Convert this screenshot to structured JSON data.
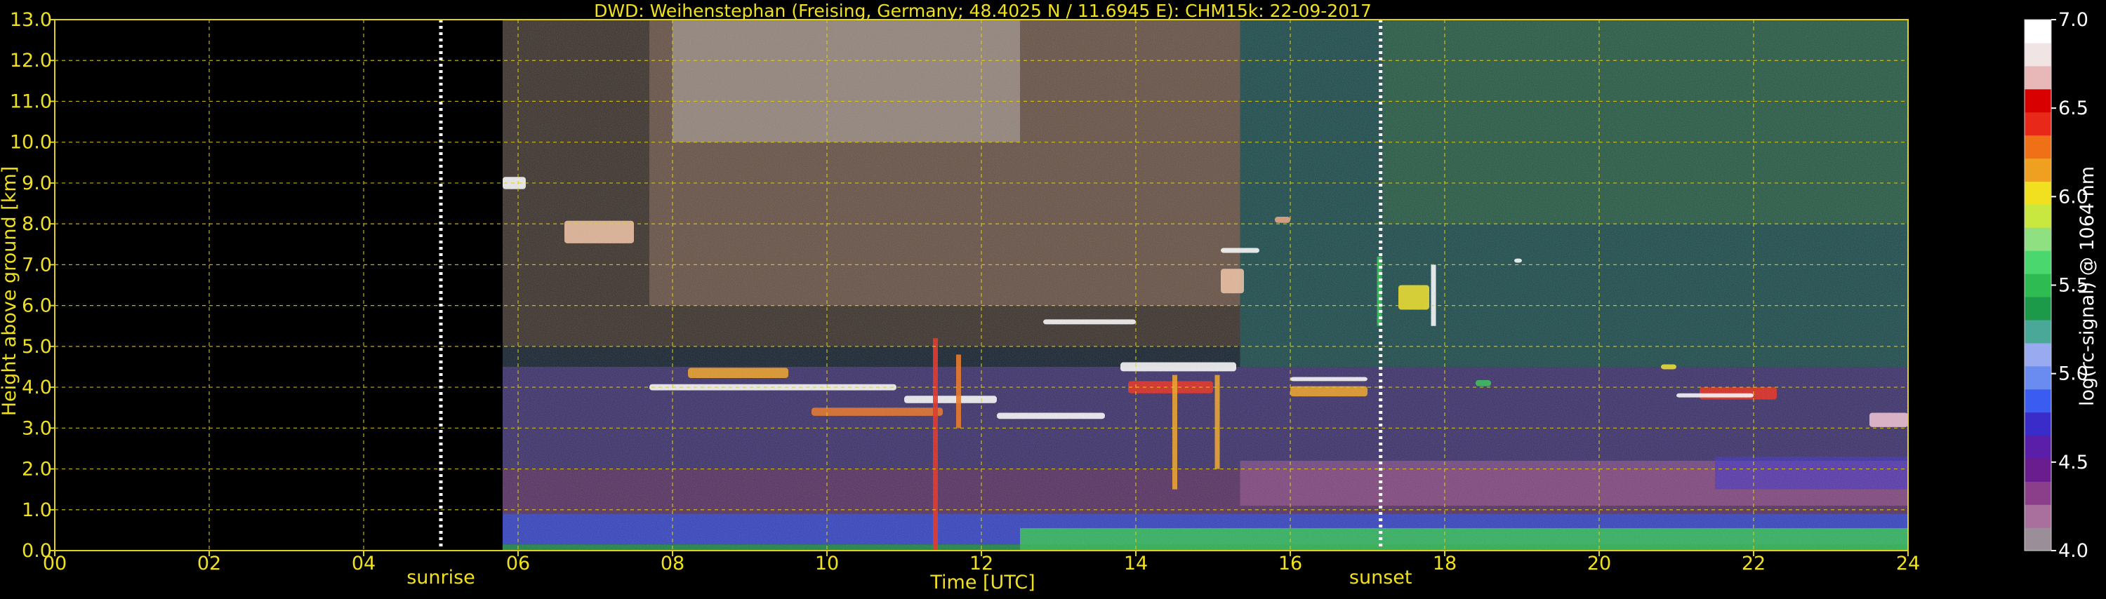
{
  "chart_data": {
    "type": "heatmap",
    "title": "DWD: Weihenstephan (Freising, Germany; 48.4025 N / 11.6945 E):    CHM15k: 22-09-2017",
    "xlabel": "Time [UTC]",
    "ylabel": "Height above ground [km]",
    "colorbar_label": "log(rc-signal) @ 1064 nm",
    "xlim": [
      0,
      24
    ],
    "ylim": [
      0,
      13
    ],
    "x_ticks": [
      "00",
      "02",
      "04",
      "06",
      "08",
      "10",
      "12",
      "14",
      "16",
      "18",
      "20",
      "22",
      "24"
    ],
    "x_tick_values": [
      0,
      2,
      4,
      6,
      8,
      10,
      12,
      14,
      16,
      18,
      20,
      22,
      24
    ],
    "y_ticks": [
      "0.0",
      "1.0",
      "2.0",
      "3.0",
      "4.0",
      "5.0",
      "6.0",
      "7.0",
      "8.0",
      "9.0",
      "10.0",
      "11.0",
      "12.0",
      "13.0"
    ],
    "y_tick_values": [
      0,
      1,
      2,
      3,
      4,
      5,
      6,
      7,
      8,
      9,
      10,
      11,
      12,
      13
    ],
    "colorbar_ticks": [
      "4.0",
      "4.5",
      "5.0",
      "5.5",
      "6.0",
      "6.5",
      "7.0"
    ],
    "colorbar_range": [
      4.0,
      7.0
    ],
    "colorbar_colors": [
      "#9a8e99",
      "#a9709e",
      "#8b3f8a",
      "#6a1d8e",
      "#5a1ea8",
      "#3a2cc8",
      "#3a5cf0",
      "#6a8cf0",
      "#9aaaf0",
      "#4aa898",
      "#1c9a4a",
      "#2ebc52",
      "#4ad86e",
      "#8ee080",
      "#c8e840",
      "#f0e020",
      "#f0a020",
      "#f07018",
      "#e82818",
      "#d80000",
      "#e8b8b8",
      "#f0e4e4",
      "#ffffff"
    ],
    "grid": true,
    "markers": [
      {
        "label": "sunrise",
        "x": 5.0
      },
      {
        "label": "sunset",
        "x": 17.17
      }
    ],
    "data_start_hour": 5.8,
    "background_layers": [
      {
        "x0": 5.8,
        "x1": 24.0,
        "h0": 0,
        "h1": 13.0,
        "color": "#203850",
        "opacity": 0.55
      },
      {
        "x0": 5.8,
        "x1": 15.35,
        "h0": 5.0,
        "h1": 13.0,
        "color": "#4a3628",
        "opacity": 0.7
      },
      {
        "x0": 7.7,
        "x1": 15.35,
        "h0": 6.0,
        "h1": 13.0,
        "color": "#8a6a5a",
        "opacity": 0.55
      },
      {
        "x0": 8.0,
        "x1": 12.5,
        "h0": 10.0,
        "h1": 13.0,
        "color": "#c8c0bc",
        "opacity": 0.45
      },
      {
        "x0": 15.35,
        "x1": 24.0,
        "h0": 4.5,
        "h1": 13.0,
        "color": "#1f6a62",
        "opacity": 0.55
      },
      {
        "x0": 17.2,
        "x1": 24.0,
        "h0": 8.0,
        "h1": 13.0,
        "color": "#3a7a30",
        "opacity": 0.3
      },
      {
        "x0": 5.8,
        "x1": 24.0,
        "h0": 2.0,
        "h1": 4.5,
        "color": "#5a3a9a",
        "opacity": 0.55
      },
      {
        "x0": 5.8,
        "x1": 24.0,
        "h0": 0.9,
        "h1": 2.0,
        "color": "#8a3a8a",
        "opacity": 0.55
      },
      {
        "x0": 15.35,
        "x1": 24.0,
        "h0": 1.1,
        "h1": 2.2,
        "color": "#a85a9a",
        "opacity": 0.5
      },
      {
        "x0": 5.8,
        "x1": 24.0,
        "h0": 0.15,
        "h1": 0.9,
        "color": "#3848d8",
        "opacity": 0.85
      },
      {
        "x0": 12.5,
        "x1": 24.0,
        "h0": 0.0,
        "h1": 0.55,
        "color": "#2ebc52",
        "opacity": 0.9
      },
      {
        "x0": 5.8,
        "x1": 12.5,
        "h0": 0.0,
        "h1": 0.15,
        "color": "#1c9a4a",
        "opacity": 0.8
      },
      {
        "x0": 21.5,
        "x1": 24.0,
        "h0": 1.5,
        "h1": 2.3,
        "color": "#3a2cc8",
        "opacity": 0.6
      }
    ],
    "cloud_features": [
      {
        "x0": 7.7,
        "x1": 10.9,
        "h": 4.0,
        "thickness": 0.15,
        "color": "#ffffff"
      },
      {
        "x0": 8.2,
        "x1": 9.5,
        "h": 4.35,
        "thickness": 0.25,
        "color": "#f0a020"
      },
      {
        "x0": 9.8,
        "x1": 11.5,
        "h": 3.4,
        "thickness": 0.2,
        "color": "#e87020"
      },
      {
        "x0": 11.0,
        "x1": 12.2,
        "h": 3.7,
        "thickness": 0.18,
        "color": "#ffffff"
      },
      {
        "x0": 12.2,
        "x1": 13.6,
        "h": 3.3,
        "thickness": 0.15,
        "color": "#ffffff"
      },
      {
        "x0": 13.8,
        "x1": 15.3,
        "h": 4.5,
        "thickness": 0.22,
        "color": "#ffffff"
      },
      {
        "x0": 13.9,
        "x1": 15.0,
        "h": 4.0,
        "thickness": 0.3,
        "color": "#e82818"
      },
      {
        "x0": 12.8,
        "x1": 14.0,
        "h": 5.6,
        "thickness": 0.12,
        "color": "#ffffff"
      },
      {
        "x0": 16.0,
        "x1": 17.0,
        "h": 3.9,
        "thickness": 0.25,
        "color": "#f0a020"
      },
      {
        "x0": 16.0,
        "x1": 17.0,
        "h": 4.2,
        "thickness": 0.1,
        "color": "#ffffff"
      },
      {
        "x0": 5.8,
        "x1": 6.1,
        "h": 9.0,
        "thickness": 0.3,
        "color": "#ffffff"
      },
      {
        "x0": 6.6,
        "x1": 7.5,
        "h": 7.8,
        "thickness": 0.55,
        "color": "#f0c0a0"
      },
      {
        "x0": 15.1,
        "x1": 15.4,
        "h": 6.6,
        "thickness": 0.6,
        "color": "#f0c0a0"
      },
      {
        "x0": 15.1,
        "x1": 15.6,
        "h": 7.35,
        "thickness": 0.12,
        "color": "#ffffff"
      },
      {
        "x0": 17.4,
        "x1": 17.8,
        "h": 6.2,
        "thickness": 0.6,
        "color": "#f0e020"
      },
      {
        "x0": 21.3,
        "x1": 22.3,
        "h": 3.85,
        "thickness": 0.3,
        "color": "#e82818"
      },
      {
        "x0": 21.0,
        "x1": 22.0,
        "h": 3.8,
        "thickness": 0.1,
        "color": "#ffffff"
      },
      {
        "x0": 23.5,
        "x1": 24.0,
        "h": 3.2,
        "thickness": 0.35,
        "color": "#f0c0d0"
      },
      {
        "x0": 15.8,
        "x1": 16.0,
        "h": 8.1,
        "thickness": 0.15,
        "color": "#e8a080"
      },
      {
        "x0": 20.8,
        "x1": 21.0,
        "h": 4.5,
        "thickness": 0.12,
        "color": "#f0e020"
      },
      {
        "x0": 18.4,
        "x1": 18.6,
        "h": 4.1,
        "thickness": 0.15,
        "color": "#2ebc52"
      },
      {
        "x0": 18.9,
        "x1": 19.0,
        "h": 7.1,
        "thickness": 0.1,
        "color": "#ffffff"
      }
    ],
    "vertical_streaks": [
      {
        "x": 11.4,
        "h0": 0.0,
        "h1": 5.2,
        "color": "#e82818"
      },
      {
        "x": 11.7,
        "h0": 3.0,
        "h1": 4.8,
        "color": "#f07018"
      },
      {
        "x": 14.5,
        "h0": 1.5,
        "h1": 4.3,
        "color": "#f0a020"
      },
      {
        "x": 15.05,
        "h0": 2.0,
        "h1": 4.3,
        "color": "#f0a020"
      },
      {
        "x": 17.15,
        "h0": 5.5,
        "h1": 7.2,
        "color": "#2ebc52"
      },
      {
        "x": 17.85,
        "h0": 5.5,
        "h1": 7.0,
        "color": "#ffffff"
      }
    ]
  }
}
